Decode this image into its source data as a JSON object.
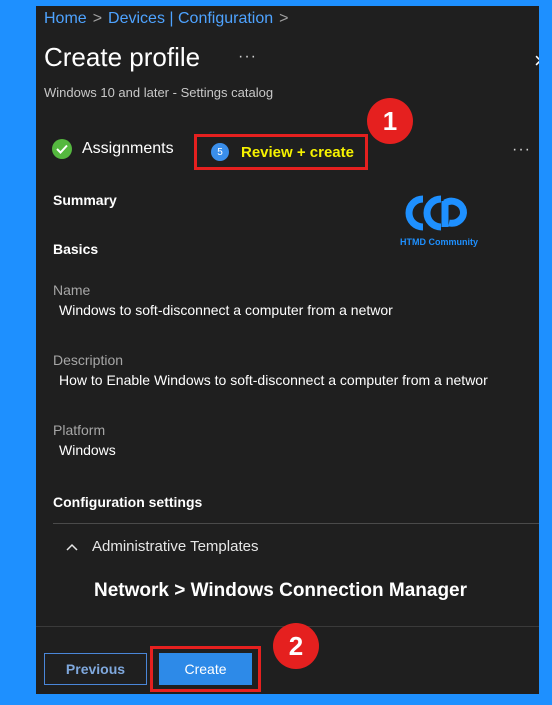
{
  "breadcrumb": {
    "items": [
      {
        "label": "Home"
      },
      {
        "label": "Devices | Configuration"
      }
    ],
    "separator": ">"
  },
  "header": {
    "title": "Create profile",
    "more": "···",
    "subtitle": "Windows 10 and later - Settings catalog",
    "close": "×"
  },
  "steps": {
    "assignments": {
      "label": "Assignments",
      "status": "complete",
      "icon": "check-icon"
    },
    "review": {
      "label": "Review + create",
      "number": "5"
    },
    "more": "···"
  },
  "annotations": {
    "badge1": "1",
    "badge2": "2",
    "highlight_color": "#e5201f"
  },
  "logo": {
    "text": "HTMD Community"
  },
  "summary": {
    "heading": "Summary",
    "basics_heading": "Basics",
    "fields": [
      {
        "label": "Name",
        "value": "Windows to soft-disconnect a computer from a networ"
      },
      {
        "label": "Description",
        "value": "How to Enable Windows to soft-disconnect a computer from a networ"
      },
      {
        "label": "Platform",
        "value": "Windows"
      }
    ],
    "config_heading": "Configuration settings",
    "accordion_label": "Administrative Templates",
    "path": "Network > Windows Connection Manager"
  },
  "footer": {
    "previous_label": "Previous",
    "create_label": "Create"
  },
  "colors": {
    "page_bg": "#1e90ff",
    "panel_bg": "#1f1f1f",
    "link": "#4ea3ff",
    "review_text": "#f6f200",
    "success": "#55b83f",
    "primary_button": "#2d8ae8"
  }
}
